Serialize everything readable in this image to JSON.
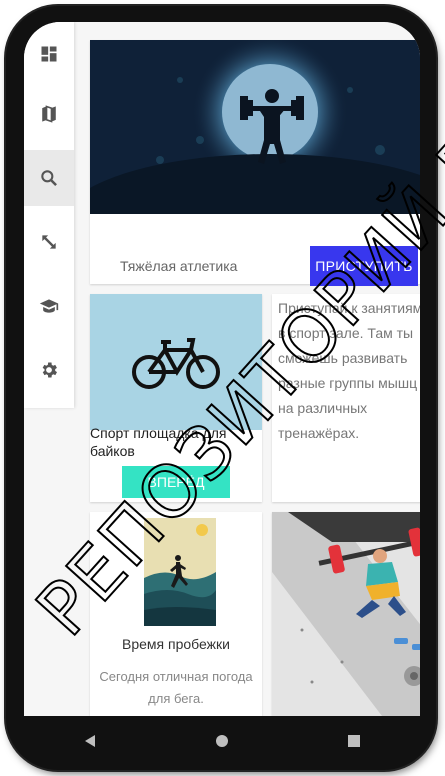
{
  "hero_card": {
    "title": "Тяжёлая атлетика",
    "button_label": "ПРИСТУПИТЬ"
  },
  "bike_card": {
    "title": "Спорт площадка для байков",
    "button_label": "ВПЕРЁД"
  },
  "gym_desc": {
    "text": "Приступай к занятиям в спорт зале. Там ты сможешь развивать разные группы мышц на различных тренажёрах."
  },
  "run_card": {
    "title": "Время пробежки",
    "text": "Сегодня отличная погода для бега."
  },
  "sidebar": {
    "items": [
      {
        "icon": "dashboard-icon"
      },
      {
        "icon": "map-icon"
      },
      {
        "icon": "search-icon"
      },
      {
        "icon": "expand-icon"
      },
      {
        "icon": "school-icon"
      },
      {
        "icon": "gear-icon"
      }
    ],
    "active_index": 2
  },
  "navbar": {
    "icons": [
      "back-icon",
      "home-icon",
      "recents-icon"
    ]
  },
  "watermark": {
    "text": "РЕПОЗИТОРИЙ ГГУ",
    "color": "#000000"
  },
  "colors": {
    "primary_button": "#3837ee",
    "secondary_button": "#34e3c4",
    "hero_bg": "#0f2138",
    "bike_bg": "#a9d4e4"
  }
}
